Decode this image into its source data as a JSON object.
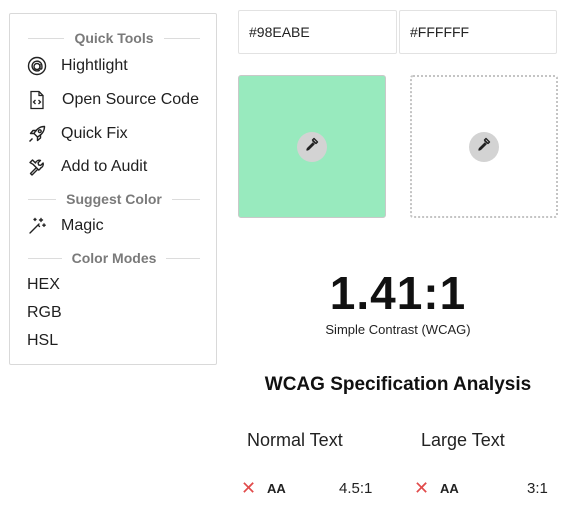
{
  "sidebar": {
    "quick_tools_title": "Quick Tools",
    "tools": [
      {
        "label": "Hightlight",
        "icon": "at-sign-circle-icon"
      },
      {
        "label": "Open Source Code",
        "icon": "code-file-icon"
      },
      {
        "label": "Quick Fix",
        "icon": "rocket-icon"
      },
      {
        "label": "Add to Audit",
        "icon": "wrench-icon"
      }
    ],
    "suggest_color_title": "Suggest Color",
    "magic_label": "Magic",
    "magic_icon": "magic-wand-icon",
    "color_modes_title": "Color Modes",
    "modes": [
      "HEX",
      "RGB",
      "HSL"
    ]
  },
  "foreground": {
    "value": "#98EABE",
    "swatch_color": "#98EABE"
  },
  "background": {
    "value": "#FFFFFF",
    "swatch_color": "#FFFFFF"
  },
  "picker_icon": "eyedropper-icon",
  "contrast": {
    "ratio": "1.41:1",
    "caption": "Simple Contrast (WCAG)"
  },
  "spec": {
    "heading": "WCAG Specification Analysis",
    "normal": {
      "title": "Normal Text",
      "level": "AA",
      "required": "4.5:1",
      "status": "fail"
    },
    "large": {
      "title": "Large Text",
      "level": "AA",
      "required": "3:1",
      "status": "fail"
    },
    "fail_symbol": "✕"
  },
  "colors": {
    "fail": "#E14B4B",
    "section_title": "#7A7A7A"
  }
}
